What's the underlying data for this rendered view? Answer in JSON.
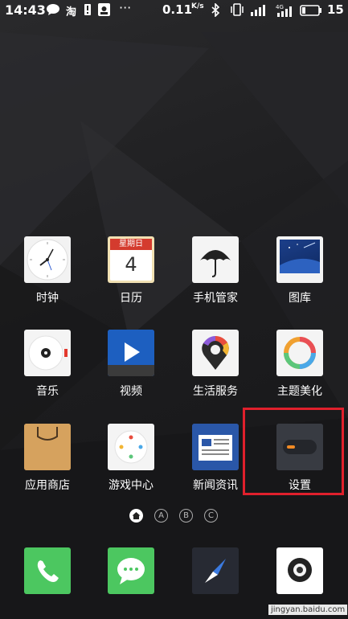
{
  "status_bar": {
    "time": "14:43",
    "net_speed": "0.11",
    "net_unit": "K/s",
    "battery": "15",
    "icons": [
      "message-icon",
      "taobao-icon",
      "notice-icon",
      "app-icon",
      "more-icon",
      "bluetooth-icon",
      "vibrate-icon",
      "signal-icon",
      "4g-signal-icon",
      "battery-icon"
    ]
  },
  "apps": [
    {
      "label": "时钟",
      "icon": "clock-icon"
    },
    {
      "label": "日历",
      "icon": "calendar-icon",
      "calendar_header": "星期日",
      "calendar_day": "4"
    },
    {
      "label": "手机管家",
      "icon": "umbrella-icon"
    },
    {
      "label": "图库",
      "icon": "gallery-icon"
    },
    {
      "label": "音乐",
      "icon": "music-icon"
    },
    {
      "label": "视频",
      "icon": "video-icon"
    },
    {
      "label": "生活服务",
      "icon": "location-pin-icon"
    },
    {
      "label": "主题美化",
      "icon": "theme-ring-icon"
    },
    {
      "label": "应用商店",
      "icon": "shopping-bag-icon"
    },
    {
      "label": "游戏中心",
      "icon": "gamepad-icon"
    },
    {
      "label": "新闻资讯",
      "icon": "newspaper-icon"
    },
    {
      "label": "设置",
      "icon": "settings-toggle-icon"
    }
  ],
  "page_indicators": [
    "A",
    "B",
    "C"
  ],
  "dock": [
    {
      "icon": "phone-icon"
    },
    {
      "icon": "chat-bubble-icon"
    },
    {
      "icon": "compass-icon"
    },
    {
      "icon": "camera-icon"
    }
  ],
  "watermark": "jingyan.baidu.com",
  "colors": {
    "highlight_border": "#e0202c",
    "phone_green": "#4cc760",
    "video_blue": "#2a6fd1",
    "news_blue": "#2a57a8"
  }
}
